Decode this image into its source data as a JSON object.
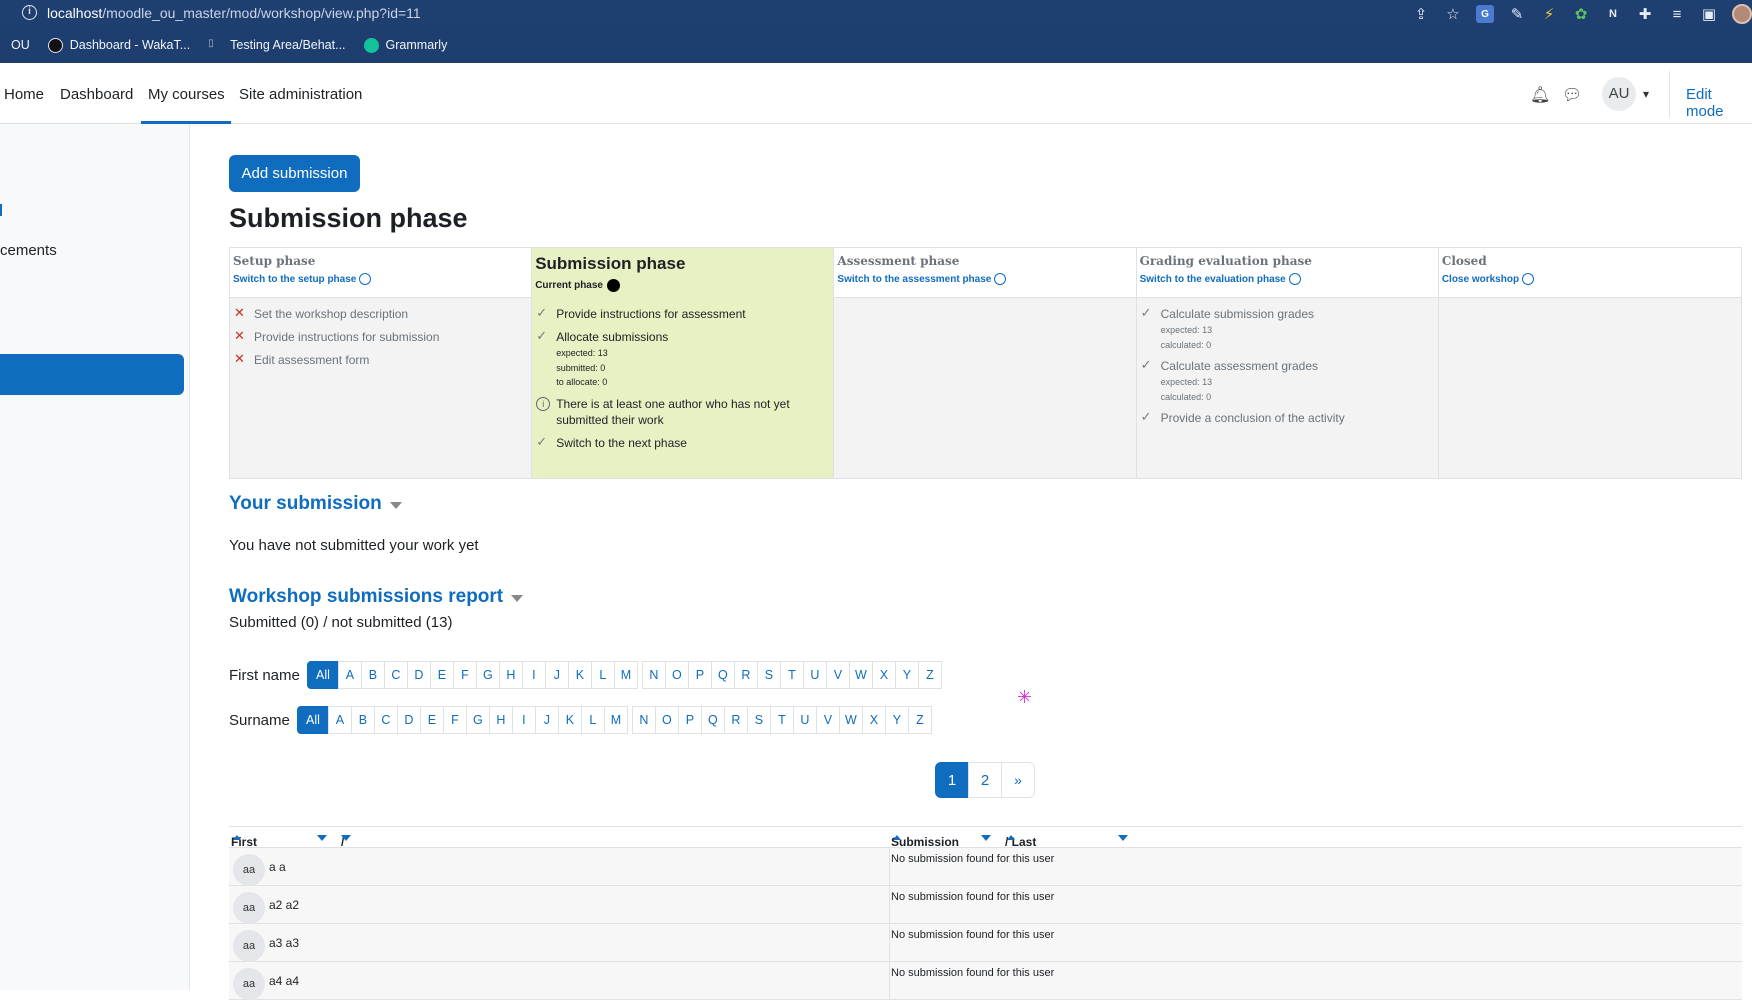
{
  "browser": {
    "url_host": "localhost",
    "url_path": "/moodle_ou_master/mod/workshop/view.php?id=11",
    "bookmarks": [
      "OU",
      "Dashboard - WakaT...",
      "Testing Area/Behat...",
      "Grammarly"
    ]
  },
  "nav": {
    "items": [
      "Home",
      "Dashboard",
      "My courses",
      "Site administration"
    ],
    "avatar": "AU",
    "edit_mode": "Edit mode"
  },
  "drawer": {
    "partial_label": "cements"
  },
  "main": {
    "add_submission": "Add submission",
    "title": "Submission phase"
  },
  "phases": {
    "setup": {
      "title": "Setup phase",
      "link": "Switch to the setup phase",
      "tasks": [
        "Set the workshop description",
        "Provide instructions for submission",
        "Edit assessment form"
      ]
    },
    "submission": {
      "title": "Submission phase",
      "current": "Current phase",
      "task1": "Provide instructions for assessment",
      "task2": "Allocate submissions",
      "task2_sub": [
        "expected: 13",
        "submitted: 0",
        "to allocate: 0"
      ],
      "info": "There is at least one author who has not yet submitted their work",
      "task3": "Switch to the next phase"
    },
    "assessment": {
      "title": "Assessment phase",
      "link": "Switch to the assessment phase"
    },
    "grading": {
      "title": "Grading evaluation phase",
      "link": "Switch to the evaluation phase",
      "task1": "Calculate submission grades",
      "task1_sub": [
        "expected: 13",
        "calculated: 0"
      ],
      "task2": "Calculate assessment grades",
      "task2_sub": [
        "expected: 13",
        "calculated: 0"
      ],
      "task3": "Provide a conclusion of the activity"
    },
    "closed": {
      "title": "Closed",
      "link": "Close workshop"
    }
  },
  "your_submission": {
    "title": "Your submission",
    "text": "You have not submitted your work yet"
  },
  "report": {
    "title": "Workshop submissions report",
    "summary": "Submitted (0) / not submitted (13)",
    "firstname_label": "First name",
    "surname_label": "Surname",
    "all": "All",
    "letters1": [
      "A",
      "B",
      "C",
      "D",
      "E",
      "F",
      "G",
      "H",
      "I",
      "J",
      "K",
      "L",
      "M"
    ],
    "letters2": [
      "N",
      "O",
      "P",
      "Q",
      "R",
      "S",
      "T",
      "U",
      "V",
      "W",
      "X",
      "Y",
      "Z"
    ],
    "pages": [
      "1",
      "2",
      "»"
    ],
    "columns": {
      "first": "First name",
      "surname": "/ Surname",
      "submission": "Submission",
      "modified": "/ Last modified"
    },
    "rows": [
      {
        "initials": "aa",
        "name": "a a",
        "status": "No submission found for this user"
      },
      {
        "initials": "aa",
        "name": "a2 a2",
        "status": "No submission found for this user"
      },
      {
        "initials": "aa",
        "name": "a3 a3",
        "status": "No submission found for this user"
      },
      {
        "initials": "aa",
        "name": "a4 a4",
        "status": "No submission found for this user"
      }
    ]
  }
}
